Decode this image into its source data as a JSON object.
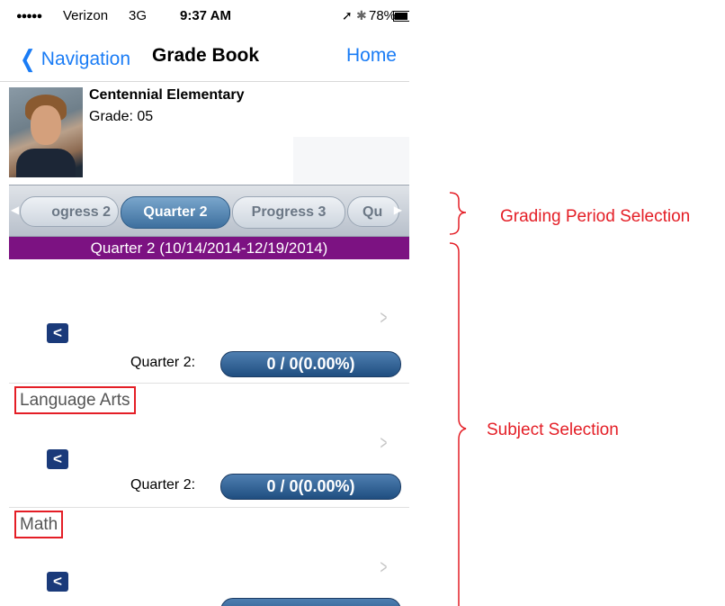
{
  "status_bar": {
    "signal": "●●●●●",
    "carrier": "Verizon",
    "network": "3G",
    "time": "9:37 AM",
    "location_icon": "➚",
    "bluetooth_icon": "✱",
    "battery": "78%"
  },
  "nav": {
    "back_label": "Navigation",
    "back_chevron": "❮",
    "title": "Grade Book",
    "home_label": "Home"
  },
  "school": {
    "name": "Centennial Elementary",
    "grade": "Grade: 05"
  },
  "periods": {
    "items": [
      "ogress 2",
      "Quarter 2",
      "Progress 3",
      "Qu"
    ],
    "selected": "Quarter 2",
    "left_arrow": "◀",
    "right_arrow": "▶"
  },
  "banner": "Quarter 2 (10/14/2014-12/19/2014)",
  "subjects": [
    {
      "name": "",
      "quarter_label": "Quarter 2:",
      "score": "0 / 0(0.00%)"
    },
    {
      "name": "Language Arts",
      "quarter_label": "Quarter 2:",
      "score": "0 / 0(0.00%)"
    },
    {
      "name": "Math",
      "quarter_label": "",
      "score": ""
    }
  ],
  "share_glyph": "<",
  "disclosure_glyph": ">",
  "annotations": {
    "grading_period": "Grading Period Selection",
    "subject": "Subject Selection",
    "color": "#e41e26"
  }
}
